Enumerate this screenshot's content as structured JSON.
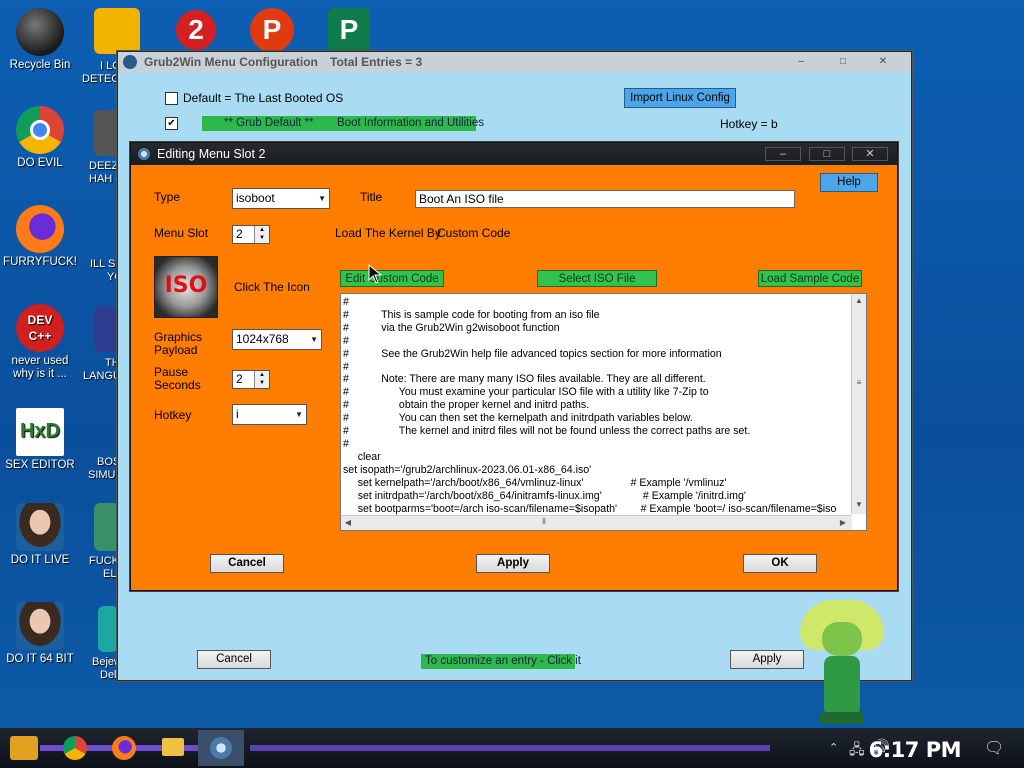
{
  "desktop": {
    "icons": [
      {
        "label": "Recycle Bin"
      },
      {
        "label": "DO EVIL"
      },
      {
        "label": "FURRYFUCK!"
      },
      {
        "label": "never used why is it ..."
      },
      {
        "label": "SEX EDITOR"
      },
      {
        "label": "DO IT LIVE"
      },
      {
        "label": "DO IT 64 BIT"
      }
    ],
    "partial_labels": [
      "I LO",
      "DETEC",
      "DEEZ",
      "HAH C",
      "ILL SI",
      "YO",
      "TH",
      "LANGU",
      "BOS",
      "SIMUL",
      "FUCK",
      "EL",
      "Bejew",
      "Del"
    ]
  },
  "back_window": {
    "title": "Grub2Win Menu Configuration",
    "total_entries": "Total Entries = 3",
    "default_checkbox_label": "Default = The Last Booted OS",
    "import_button": "Import Linux Config",
    "entry_prefix": "** Grub Default **",
    "entry_name": "Boot Information and Utilities",
    "hotkey": "Hotkey = b",
    "cancel": "Cancel",
    "customize_hint": "To customize an entry - Click it",
    "apply": "Apply",
    "controls": {
      "minimize": "–",
      "maximize": "□",
      "close": "✕"
    }
  },
  "dialog": {
    "title": "Editing Menu Slot 2",
    "controls": {
      "minimize": "–",
      "maximize": "□",
      "close": "✕"
    },
    "type_label": "Type",
    "type_value": "isoboot",
    "title_label": "Title",
    "title_value": "Boot An ISO file",
    "help": "Help",
    "menu_slot_label": "Menu Slot",
    "menu_slot_value": "2",
    "load_kernel_label": "Load The Kernel By",
    "load_kernel_value": "Custom Code",
    "iso_icon_text": "ISO",
    "click_icon": "Click The Icon",
    "edit_custom_code": "Edit Custom Code",
    "select_iso_file": "Select ISO File",
    "load_sample_code": "Load Sample Code",
    "graphics_payload_label": "Graphics Payload",
    "graphics_payload_value": "1024x768",
    "pause_seconds_label": "Pause Seconds",
    "pause_seconds_value": "2",
    "hotkey_label": "Hotkey",
    "hotkey_value": "i",
    "code": "#\n#           This is sample code for booting from an iso file\n#           via the Grub2Win g2wisoboot function\n#\n#           See the Grub2Win help file advanced topics section for more information\n#\n#           Note: There are many many ISO files available. They are all different.\n#                 You must examine your particular ISO file with a utility like 7-Zip to\n#                 obtain the proper kernel and initrd paths.\n#                 You can then set the kernelpath and initrdpath variables below.\n#                 The kernel and initrd files will not be found unless the correct paths are set.\n#\n     clear\nset isopath='/grub2/archlinux-2023.06.01-x86_64.iso'\n     set kernelpath='/arch/boot/x86_64/vmlinuz-linux'                # Example '/vmlinuz'\n     set initrdpath='/arch/boot/x86_64/initramfs-linux.img'              # Example '/initrd.img'\n     set bootparms='boot=/arch iso-scan/filename=$isopath'        # Example 'boot=/ iso-scan/filename=$iso",
    "cancel": "Cancel",
    "apply": "Apply",
    "ok": "OK"
  },
  "taskbar": {
    "clock": "6:17 PM"
  }
}
